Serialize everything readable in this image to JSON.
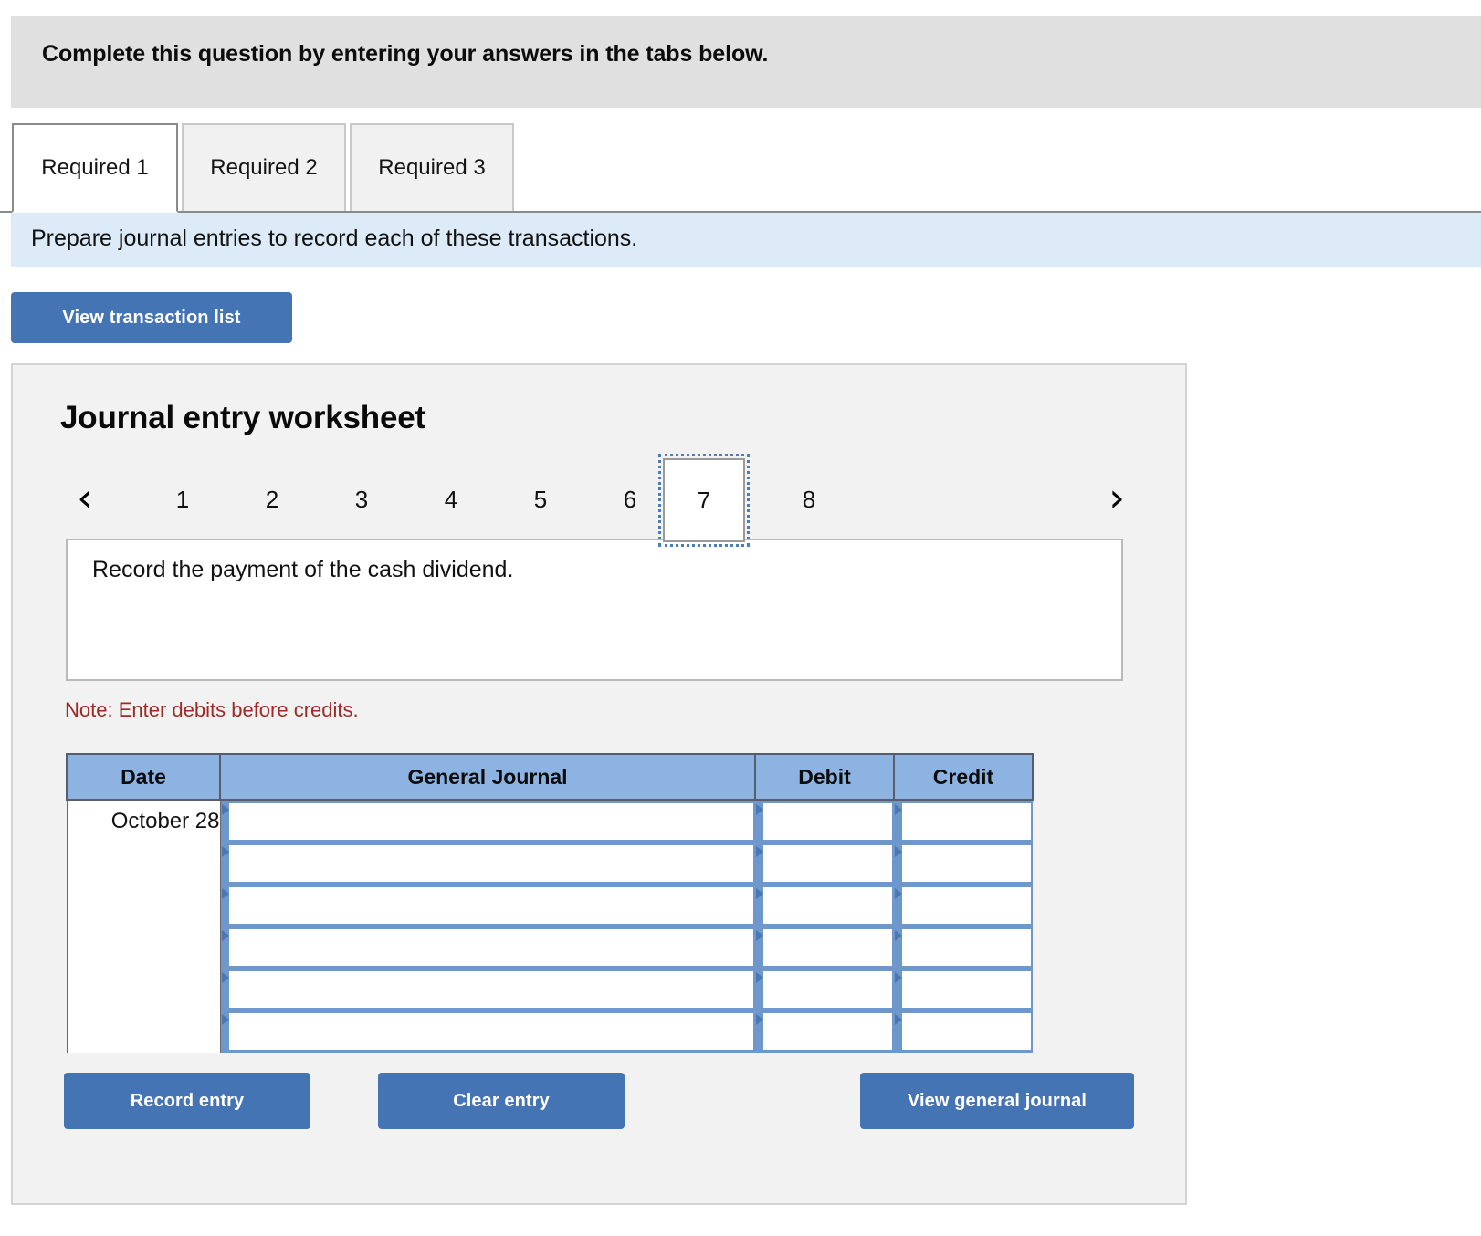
{
  "header": {
    "instruction": "Complete this question by entering your answers in the tabs below."
  },
  "tabs": {
    "items": [
      {
        "label": "Required 1",
        "active": true
      },
      {
        "label": "Required 2",
        "active": false
      },
      {
        "label": "Required 3",
        "active": false
      }
    ]
  },
  "subinstruction": {
    "text": "Prepare journal entries to record each of these transactions."
  },
  "toolbar": {
    "view_transaction_list_label": "View transaction list"
  },
  "worksheet": {
    "title": "Journal entry worksheet",
    "pager": {
      "prev_icon": "chevron-left-icon",
      "next_icon": "chevron-right-icon",
      "prev_glyph": "‹",
      "next_glyph": "›",
      "pages": [
        "1",
        "2",
        "3",
        "4",
        "5",
        "6",
        "7",
        "8"
      ],
      "current_page": "7"
    },
    "transaction": {
      "description": "Record the payment of the cash dividend."
    },
    "note": "Note: Enter debits before credits.",
    "table": {
      "columns": [
        "Date",
        "General Journal",
        "Debit",
        "Credit"
      ],
      "rows": [
        {
          "date": "October 28",
          "general_journal": "",
          "debit": "",
          "credit": ""
        },
        {
          "date": "",
          "general_journal": "",
          "debit": "",
          "credit": ""
        },
        {
          "date": "",
          "general_journal": "",
          "debit": "",
          "credit": ""
        },
        {
          "date": "",
          "general_journal": "",
          "debit": "",
          "credit": ""
        },
        {
          "date": "",
          "general_journal": "",
          "debit": "",
          "credit": ""
        },
        {
          "date": "",
          "general_journal": "",
          "debit": "",
          "credit": ""
        }
      ]
    },
    "actions": {
      "record_entry_label": "Record entry",
      "clear_entry_label": "Clear entry",
      "view_general_journal_label": "View general journal"
    }
  },
  "colors": {
    "accent_blue": "#4574b5",
    "table_header_blue": "#8cb3e2",
    "input_frame_blue": "#6e97cb",
    "instruction_band_gray": "#e0e0e0",
    "subinstruction_blue": "#dcebf7",
    "panel_gray": "#f2f2f2",
    "note_red": "#9e2a23"
  }
}
